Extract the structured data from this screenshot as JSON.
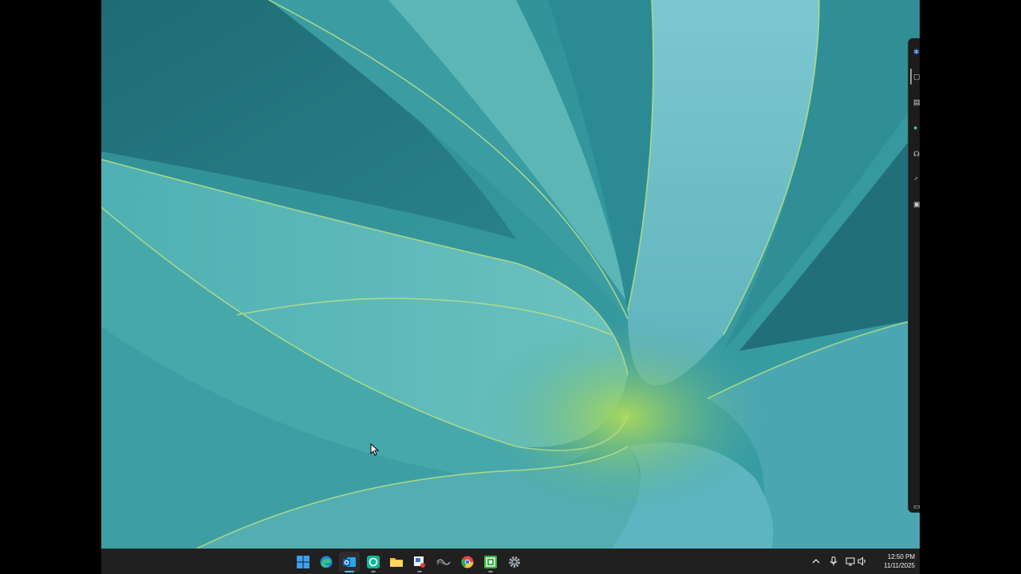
{
  "desktop": {
    "wallpaper_name": "agave-leaves",
    "colors": {
      "leaf_light": "#6fc3c3",
      "leaf_mid": "#3f9ea3",
      "leaf_dark": "#1f6f78",
      "leaf_edge": "#b7e07a",
      "taskbar_bg": "#202020",
      "accent": "#4cc2ff"
    }
  },
  "side_panel": {
    "icons": [
      "copilot-icon",
      "window-icon",
      "clipboard-icon",
      "edge-icon",
      "people-icon",
      "settings-small-icon",
      "notes-icon",
      "panel-toggle-icon"
    ]
  },
  "taskbar": {
    "apps": [
      {
        "name": "start-button",
        "icon": "windows-logo-icon"
      },
      {
        "name": "taskbar-edge",
        "icon": "edge-icon"
      },
      {
        "name": "taskbar-outlook",
        "icon": "outlook-icon",
        "active": true
      },
      {
        "name": "taskbar-app-green",
        "icon": "green-circle-app-icon"
      },
      {
        "name": "taskbar-file-explorer",
        "icon": "folder-icon"
      },
      {
        "name": "taskbar-snipping",
        "icon": "snipping-tool-icon"
      },
      {
        "name": "taskbar-feedback",
        "icon": "feedback-icon"
      },
      {
        "name": "taskbar-chrome",
        "icon": "chrome-icon"
      },
      {
        "name": "taskbar-camtasia",
        "icon": "green-cp-app-icon"
      },
      {
        "name": "taskbar-settings",
        "icon": "gear-icon"
      }
    ],
    "tray": {
      "chevron": "^",
      "icons": [
        "microphone-icon",
        "network-icon",
        "volume-icon"
      ]
    },
    "clock": {
      "time": "12:50 PM",
      "date": "11/11/2025"
    }
  }
}
